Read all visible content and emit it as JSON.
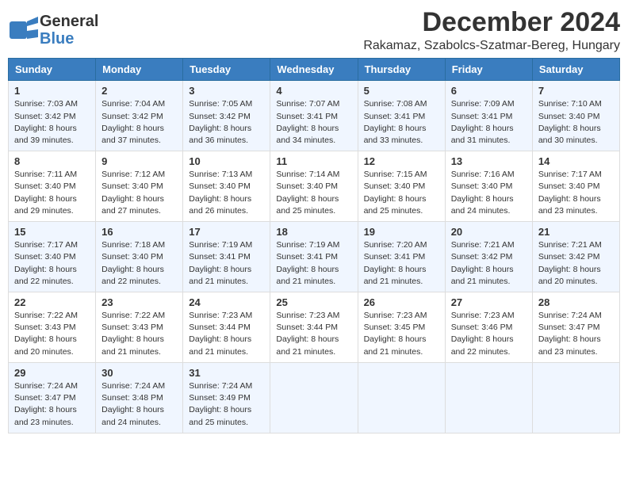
{
  "logo": {
    "general": "General",
    "blue": "Blue"
  },
  "title": "December 2024",
  "subtitle": "Rakamaz, Szabolcs-Szatmar-Bereg, Hungary",
  "days_of_week": [
    "Sunday",
    "Monday",
    "Tuesday",
    "Wednesday",
    "Thursday",
    "Friday",
    "Saturday"
  ],
  "weeks": [
    [
      {
        "day": 1,
        "sunrise": "Sunrise: 7:03 AM",
        "sunset": "Sunset: 3:42 PM",
        "daylight": "Daylight: 8 hours and 39 minutes."
      },
      {
        "day": 2,
        "sunrise": "Sunrise: 7:04 AM",
        "sunset": "Sunset: 3:42 PM",
        "daylight": "Daylight: 8 hours and 37 minutes."
      },
      {
        "day": 3,
        "sunrise": "Sunrise: 7:05 AM",
        "sunset": "Sunset: 3:42 PM",
        "daylight": "Daylight: 8 hours and 36 minutes."
      },
      {
        "day": 4,
        "sunrise": "Sunrise: 7:07 AM",
        "sunset": "Sunset: 3:41 PM",
        "daylight": "Daylight: 8 hours and 34 minutes."
      },
      {
        "day": 5,
        "sunrise": "Sunrise: 7:08 AM",
        "sunset": "Sunset: 3:41 PM",
        "daylight": "Daylight: 8 hours and 33 minutes."
      },
      {
        "day": 6,
        "sunrise": "Sunrise: 7:09 AM",
        "sunset": "Sunset: 3:41 PM",
        "daylight": "Daylight: 8 hours and 31 minutes."
      },
      {
        "day": 7,
        "sunrise": "Sunrise: 7:10 AM",
        "sunset": "Sunset: 3:40 PM",
        "daylight": "Daylight: 8 hours and 30 minutes."
      }
    ],
    [
      {
        "day": 8,
        "sunrise": "Sunrise: 7:11 AM",
        "sunset": "Sunset: 3:40 PM",
        "daylight": "Daylight: 8 hours and 29 minutes."
      },
      {
        "day": 9,
        "sunrise": "Sunrise: 7:12 AM",
        "sunset": "Sunset: 3:40 PM",
        "daylight": "Daylight: 8 hours and 27 minutes."
      },
      {
        "day": 10,
        "sunrise": "Sunrise: 7:13 AM",
        "sunset": "Sunset: 3:40 PM",
        "daylight": "Daylight: 8 hours and 26 minutes."
      },
      {
        "day": 11,
        "sunrise": "Sunrise: 7:14 AM",
        "sunset": "Sunset: 3:40 PM",
        "daylight": "Daylight: 8 hours and 25 minutes."
      },
      {
        "day": 12,
        "sunrise": "Sunrise: 7:15 AM",
        "sunset": "Sunset: 3:40 PM",
        "daylight": "Daylight: 8 hours and 25 minutes."
      },
      {
        "day": 13,
        "sunrise": "Sunrise: 7:16 AM",
        "sunset": "Sunset: 3:40 PM",
        "daylight": "Daylight: 8 hours and 24 minutes."
      },
      {
        "day": 14,
        "sunrise": "Sunrise: 7:17 AM",
        "sunset": "Sunset: 3:40 PM",
        "daylight": "Daylight: 8 hours and 23 minutes."
      }
    ],
    [
      {
        "day": 15,
        "sunrise": "Sunrise: 7:17 AM",
        "sunset": "Sunset: 3:40 PM",
        "daylight": "Daylight: 8 hours and 22 minutes."
      },
      {
        "day": 16,
        "sunrise": "Sunrise: 7:18 AM",
        "sunset": "Sunset: 3:40 PM",
        "daylight": "Daylight: 8 hours and 22 minutes."
      },
      {
        "day": 17,
        "sunrise": "Sunrise: 7:19 AM",
        "sunset": "Sunset: 3:41 PM",
        "daylight": "Daylight: 8 hours and 21 minutes."
      },
      {
        "day": 18,
        "sunrise": "Sunrise: 7:19 AM",
        "sunset": "Sunset: 3:41 PM",
        "daylight": "Daylight: 8 hours and 21 minutes."
      },
      {
        "day": 19,
        "sunrise": "Sunrise: 7:20 AM",
        "sunset": "Sunset: 3:41 PM",
        "daylight": "Daylight: 8 hours and 21 minutes."
      },
      {
        "day": 20,
        "sunrise": "Sunrise: 7:21 AM",
        "sunset": "Sunset: 3:42 PM",
        "daylight": "Daylight: 8 hours and 21 minutes."
      },
      {
        "day": 21,
        "sunrise": "Sunrise: 7:21 AM",
        "sunset": "Sunset: 3:42 PM",
        "daylight": "Daylight: 8 hours and 20 minutes."
      }
    ],
    [
      {
        "day": 22,
        "sunrise": "Sunrise: 7:22 AM",
        "sunset": "Sunset: 3:43 PM",
        "daylight": "Daylight: 8 hours and 20 minutes."
      },
      {
        "day": 23,
        "sunrise": "Sunrise: 7:22 AM",
        "sunset": "Sunset: 3:43 PM",
        "daylight": "Daylight: 8 hours and 21 minutes."
      },
      {
        "day": 24,
        "sunrise": "Sunrise: 7:23 AM",
        "sunset": "Sunset: 3:44 PM",
        "daylight": "Daylight: 8 hours and 21 minutes."
      },
      {
        "day": 25,
        "sunrise": "Sunrise: 7:23 AM",
        "sunset": "Sunset: 3:44 PM",
        "daylight": "Daylight: 8 hours and 21 minutes."
      },
      {
        "day": 26,
        "sunrise": "Sunrise: 7:23 AM",
        "sunset": "Sunset: 3:45 PM",
        "daylight": "Daylight: 8 hours and 21 minutes."
      },
      {
        "day": 27,
        "sunrise": "Sunrise: 7:23 AM",
        "sunset": "Sunset: 3:46 PM",
        "daylight": "Daylight: 8 hours and 22 minutes."
      },
      {
        "day": 28,
        "sunrise": "Sunrise: 7:24 AM",
        "sunset": "Sunset: 3:47 PM",
        "daylight": "Daylight: 8 hours and 23 minutes."
      }
    ],
    [
      {
        "day": 29,
        "sunrise": "Sunrise: 7:24 AM",
        "sunset": "Sunset: 3:47 PM",
        "daylight": "Daylight: 8 hours and 23 minutes."
      },
      {
        "day": 30,
        "sunrise": "Sunrise: 7:24 AM",
        "sunset": "Sunset: 3:48 PM",
        "daylight": "Daylight: 8 hours and 24 minutes."
      },
      {
        "day": 31,
        "sunrise": "Sunrise: 7:24 AM",
        "sunset": "Sunset: 3:49 PM",
        "daylight": "Daylight: 8 hours and 25 minutes."
      },
      null,
      null,
      null,
      null
    ]
  ]
}
